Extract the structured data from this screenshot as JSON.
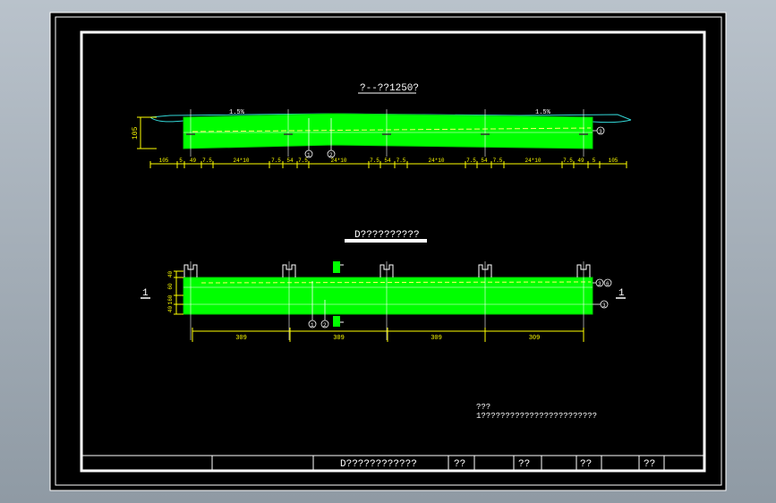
{
  "colors": {
    "background": "#000000",
    "frame": "#ffffff",
    "fill": "#00ff00",
    "dimension": "#ffff00",
    "line": "#ffffff",
    "outer": "#9aa5af"
  },
  "section1": {
    "title": "?--??1250?",
    "height_dim": "105",
    "slope_left": "1.5%",
    "slope_right": "1.5%",
    "dims": [
      "105",
      "5",
      "49",
      "7.5",
      "24*10",
      "7.5",
      "54",
      "7.5",
      "24*10",
      "7.5",
      "54",
      "7.5",
      "24*10",
      "7.5",
      "54",
      "7.5",
      "24*10",
      "7.5",
      "49",
      "5",
      "105"
    ],
    "callouts": [
      "1",
      "2",
      "3"
    ]
  },
  "section2": {
    "title": "D??????????",
    "left_dims": [
      "40",
      "60",
      "160",
      "40"
    ],
    "section_mark_left": "1",
    "section_mark_right": "1",
    "bottom_dims": [
      "309",
      "309",
      "309",
      "309"
    ],
    "callouts": [
      "1",
      "2",
      "3",
      "3",
      "6"
    ]
  },
  "notes": {
    "line1": "???",
    "line2": "1????????????????????????"
  },
  "title_block": {
    "drawing_name": "D????????????",
    "cells": [
      "??",
      "??",
      "??",
      "??"
    ]
  }
}
